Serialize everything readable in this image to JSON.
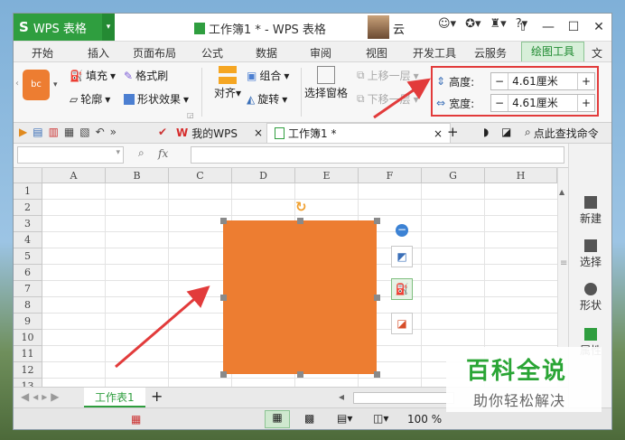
{
  "app": {
    "name": "WPS 表格",
    "logo_glyph": "S"
  },
  "title": {
    "doc": "工作簿1 * - WPS 表格",
    "user": "云"
  },
  "menu": {
    "items": [
      "开始",
      "插入",
      "页面布局",
      "公式",
      "数据",
      "审阅",
      "视图",
      "开发工具",
      "云服务",
      "绘图工具",
      "文"
    ],
    "active": "绘图工具"
  },
  "ribbon": {
    "thumb_label": "bc",
    "fill": "填充",
    "format_brush": "格式刷",
    "outline": "轮廓",
    "shape_effect": "形状效果",
    "align": "对齐",
    "group": "组合",
    "rotate": "旋转",
    "select_pane": "选择窗格",
    "bring_forward": "上移一层",
    "send_backward": "下移一层",
    "height_label": "高度:",
    "height_value": "4.61厘米",
    "width_label": "宽度:",
    "width_value": "4.61厘米",
    "minus": "−",
    "plus": "+"
  },
  "tabs": {
    "my_wps": "我的WPS",
    "workbook": "工作簿1 *",
    "search": "点此查找命令",
    "add": "+",
    "close": "×"
  },
  "formula": {
    "fx": "fx"
  },
  "columns": [
    "A",
    "B",
    "C",
    "D",
    "E",
    "F",
    "G",
    "H"
  ],
  "rows": [
    "1",
    "2",
    "3",
    "4",
    "5",
    "6",
    "7",
    "8",
    "9",
    "10",
    "11",
    "12",
    "13"
  ],
  "shape": {
    "color": "#ed7d31"
  },
  "right_panel": {
    "new": "新建",
    "select": "选择",
    "shape": "形状",
    "props": "属性"
  },
  "sheets": {
    "current": "工作表1",
    "add": "+"
  },
  "status": {
    "zoom": "100 %"
  },
  "watermark": {
    "title": "百科全说",
    "subtitle": "助你轻松解决"
  },
  "colors": {
    "accent_green": "#2f9e3f",
    "highlight_red": "#e23b3b",
    "shape_orange": "#ed7d31"
  }
}
